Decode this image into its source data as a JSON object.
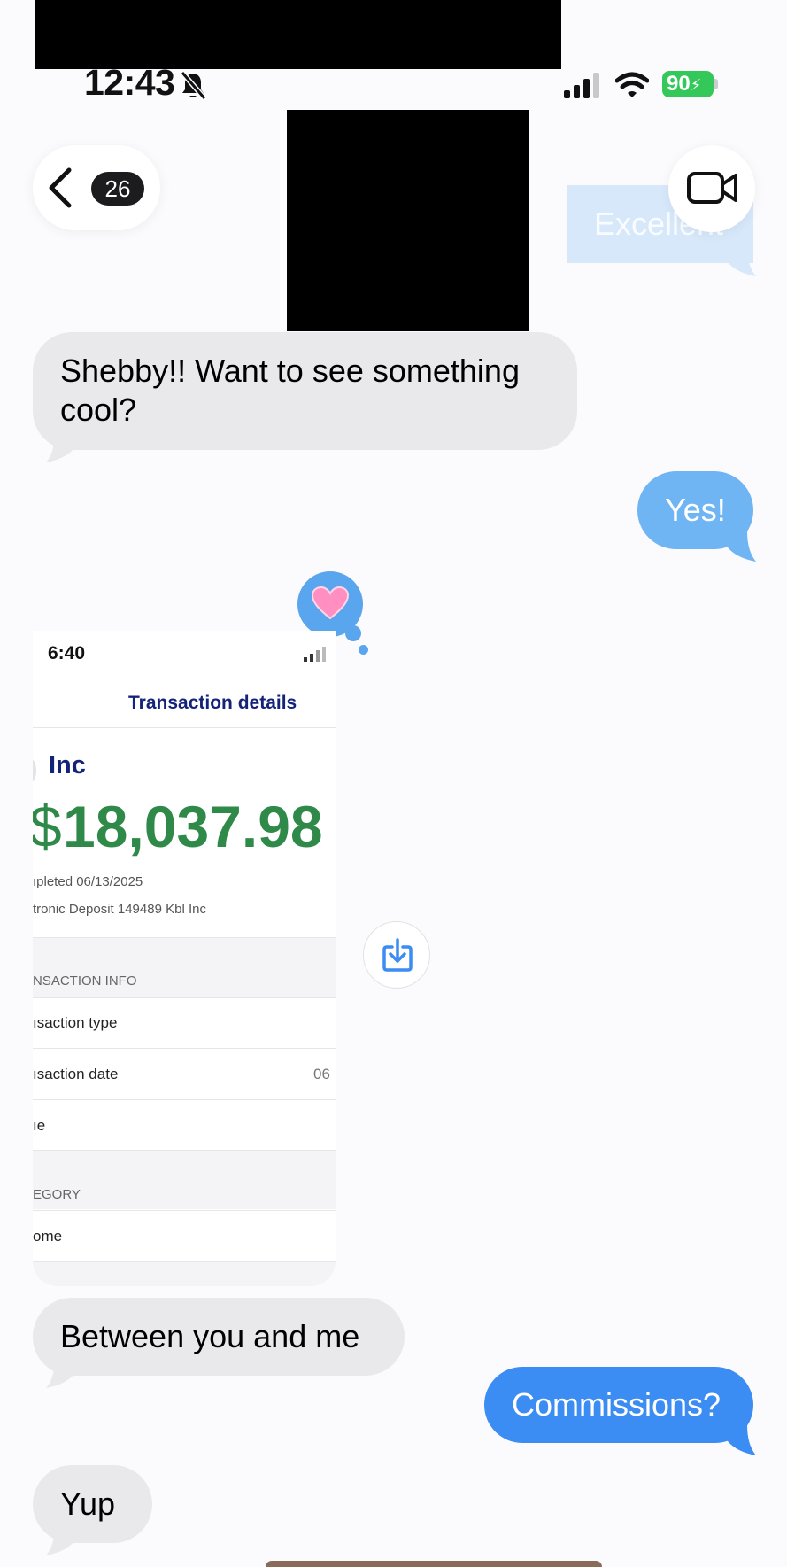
{
  "status_bar": {
    "time": "12:43",
    "battery": "90"
  },
  "header": {
    "back_count": "26"
  },
  "messages": {
    "m0_excellent": "Excellent",
    "m1_shebby": "Shebby!! Want to see something cool?",
    "m2_yes": "Yes!",
    "m3_between": "Between you and me",
    "m4_commissions": "Commissions?",
    "m5_yup": "Yup"
  },
  "reaction": {
    "icon": "heart-icon",
    "color": "#ff8fc0"
  },
  "attachment": {
    "time": "6:40",
    "title": "Transaction details",
    "payer": "Inc",
    "dollar_sign": "$",
    "amount": "18,037.98",
    "completed": "ıpleted 06/13/2025",
    "deposit_desc": "tronic Deposit 149489 Kbl Inc",
    "section_info": "NSACTION INFO",
    "row_type": "ısaction type",
    "row_date": "ısaction date",
    "row_date_value": "06",
    "row_name": "ıe",
    "section_category": "EGORY",
    "row_category": "ome"
  },
  "colors": {
    "imessage_blue": "#3b8cf3",
    "received_gray": "#e9e9eb",
    "amount_green": "#2f8a4a",
    "title_navy": "#14237a"
  }
}
